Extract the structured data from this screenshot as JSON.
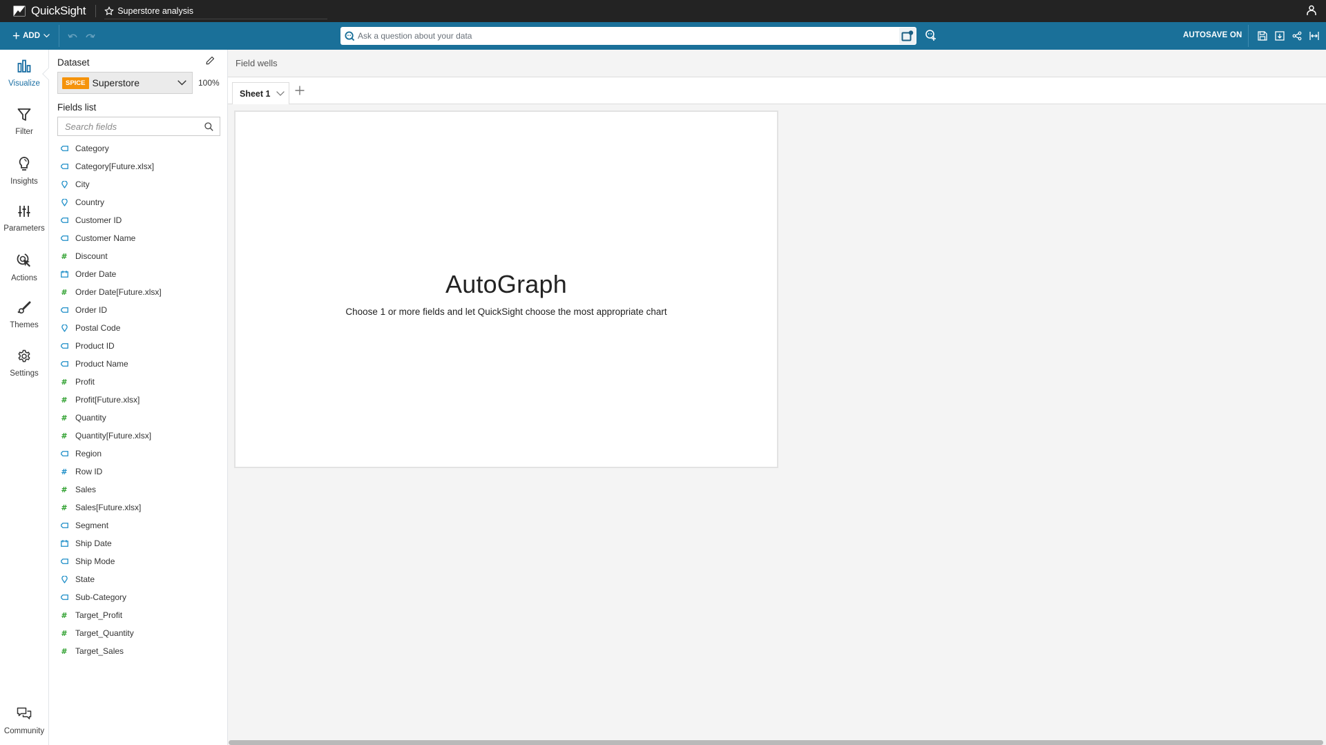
{
  "app": {
    "name": "QuickSight",
    "analysis_title": "Superstore analysis"
  },
  "toolbar": {
    "add_label": "ADD",
    "question_placeholder": "Ask a question about your data",
    "autosave_label": "AUTOSAVE ON"
  },
  "nav": {
    "items": [
      {
        "label": "Visualize",
        "icon": "bar-chart-icon",
        "active": true
      },
      {
        "label": "Filter",
        "icon": "filter-icon"
      },
      {
        "label": "Insights",
        "icon": "lightbulb-icon"
      },
      {
        "label": "Parameters",
        "icon": "sliders-icon"
      },
      {
        "label": "Actions",
        "icon": "cursor-click-icon"
      },
      {
        "label": "Themes",
        "icon": "brush-icon"
      },
      {
        "label": "Settings",
        "icon": "gear-icon"
      }
    ],
    "community_label": "Community"
  },
  "dataset": {
    "label": "Dataset",
    "badge": "SPICE",
    "name": "Superstore",
    "percent": "100%",
    "fields_label": "Fields list",
    "search_placeholder": "Search fields",
    "fields": [
      {
        "name": "Category",
        "type": "dimension"
      },
      {
        "name": "Category[Future.xlsx]",
        "type": "dimension"
      },
      {
        "name": "City",
        "type": "geo"
      },
      {
        "name": "Country",
        "type": "geo"
      },
      {
        "name": "Customer ID",
        "type": "dimension"
      },
      {
        "name": "Customer Name",
        "type": "dimension"
      },
      {
        "name": "Discount",
        "type": "measure"
      },
      {
        "name": "Order Date",
        "type": "date"
      },
      {
        "name": "Order Date[Future.xlsx]",
        "type": "measure"
      },
      {
        "name": "Order ID",
        "type": "dimension"
      },
      {
        "name": "Postal Code",
        "type": "geo"
      },
      {
        "name": "Product ID",
        "type": "dimension"
      },
      {
        "name": "Product Name",
        "type": "dimension"
      },
      {
        "name": "Profit",
        "type": "measure"
      },
      {
        "name": "Profit[Future.xlsx]",
        "type": "measure"
      },
      {
        "name": "Quantity",
        "type": "measure"
      },
      {
        "name": "Quantity[Future.xlsx]",
        "type": "measure"
      },
      {
        "name": "Region",
        "type": "dimension"
      },
      {
        "name": "Row ID",
        "type": "numeric-dimension"
      },
      {
        "name": "Sales",
        "type": "measure"
      },
      {
        "name": "Sales[Future.xlsx]",
        "type": "measure"
      },
      {
        "name": "Segment",
        "type": "dimension"
      },
      {
        "name": "Ship Date",
        "type": "date"
      },
      {
        "name": "Ship Mode",
        "type": "dimension"
      },
      {
        "name": "State",
        "type": "geo"
      },
      {
        "name": "Sub-Category",
        "type": "dimension"
      },
      {
        "name": "Target_Profit",
        "type": "measure"
      },
      {
        "name": "Target_Quantity",
        "type": "measure"
      },
      {
        "name": "Target_Sales",
        "type": "measure"
      }
    ]
  },
  "main": {
    "field_wells_label": "Field wells",
    "sheets": [
      {
        "label": "Sheet 1",
        "active": true
      }
    ],
    "visual": {
      "title": "AutoGraph",
      "subtitle": "Choose 1 or more fields and let QuickSight choose the most appropriate chart"
    }
  },
  "colors": {
    "titlebar": "#232323",
    "toolbar": "#1a7099",
    "spice_badge": "#f5930b",
    "measure_icon": "#2ea02e",
    "dimension_icon": "#1f8fc8",
    "active_nav": "#1a6ea3"
  }
}
